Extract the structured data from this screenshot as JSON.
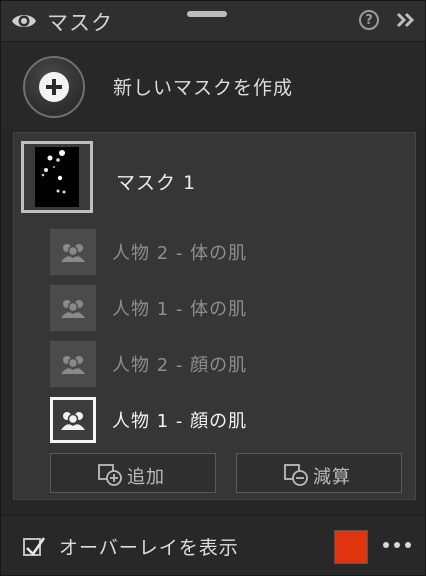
{
  "header": {
    "title": "マスク"
  },
  "new_mask": {
    "label": "新しいマスクを作成"
  },
  "mask": {
    "title": "マスク 1",
    "items": [
      {
        "label": "人物 2 - 体の肌",
        "selected": false
      },
      {
        "label": "人物 1 - 体の肌",
        "selected": false
      },
      {
        "label": "人物 2 - 顔の肌",
        "selected": false
      },
      {
        "label": "人物 1 - 顔の肌",
        "selected": true
      }
    ],
    "add_label": "追加",
    "subtract_label": "減算"
  },
  "footer": {
    "overlay_label": "オーバーレイを表示",
    "overlay_checked": true,
    "overlay_color": "#e0340f"
  },
  "icons": [
    "eye-icon",
    "help-icon",
    "expand-icon",
    "add-icon",
    "people-icon",
    "add-mask-icon",
    "subtract-mask-icon",
    "checkmark-icon",
    "more-icon"
  ]
}
